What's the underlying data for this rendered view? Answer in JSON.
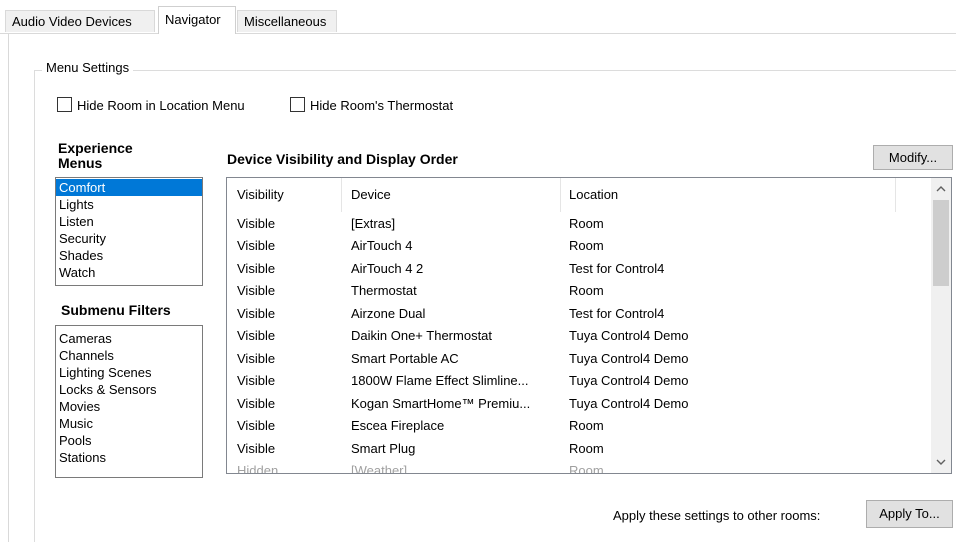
{
  "tabs": [
    {
      "label": "Audio Video Devices",
      "active": false
    },
    {
      "label": "Navigator",
      "active": true
    },
    {
      "label": "Miscellaneous",
      "active": false
    }
  ],
  "menu_settings": {
    "title": "Menu Settings",
    "hide_room_label": "Hide Room in Location Menu",
    "hide_room_checked": false,
    "hide_thermostat_label": "Hide Room's Thermostat",
    "hide_thermostat_checked": false
  },
  "experience": {
    "heading_line1": "Experience",
    "heading_line2": "Menus",
    "items": [
      "Comfort",
      "Lights",
      "Listen",
      "Security",
      "Shades",
      "Watch"
    ],
    "selected": "Comfort"
  },
  "submenu": {
    "heading": "Submenu Filters",
    "items": [
      "Cameras",
      "Channels",
      "Lighting Scenes",
      "Locks & Sensors",
      "Movies",
      "Music",
      "Pools",
      "Stations"
    ]
  },
  "devices": {
    "heading": "Device Visibility and Display Order",
    "modify_label": "Modify...",
    "columns": [
      "Visibility",
      "Device",
      "Location"
    ],
    "rows": [
      [
        "Visible",
        "[Extras]",
        "Room"
      ],
      [
        "Visible",
        "AirTouch 4",
        "Room"
      ],
      [
        "Visible",
        "AirTouch 4 2",
        "Test for Control4"
      ],
      [
        "Visible",
        "Thermostat",
        "Room"
      ],
      [
        "Visible",
        "Airzone Dual",
        "Test for Control4"
      ],
      [
        "Visible",
        "Daikin One+ Thermostat",
        "Tuya Control4 Demo"
      ],
      [
        "Visible",
        "Smart Portable AC",
        "Tuya Control4 Demo"
      ],
      [
        "Visible",
        "1800W Flame Effect Slimline...",
        "Tuya Control4 Demo"
      ],
      [
        "Visible",
        "Kogan SmartHome™ Premiu...",
        "Tuya Control4 Demo"
      ],
      [
        "Visible",
        "Escea Fireplace",
        "Room"
      ],
      [
        "Visible",
        "Smart Plug",
        "Room"
      ],
      [
        "Hidden",
        "[Weather]",
        "Room"
      ]
    ]
  },
  "apply": {
    "text": "Apply these settings to other rooms:",
    "button": "Apply To..."
  },
  "icons": {
    "scroll_up": "chevron-up-icon",
    "scroll_down": "chevron-down-icon"
  },
  "colors": {
    "selection": "#0078d7",
    "button_bg": "#e1e1e1"
  }
}
